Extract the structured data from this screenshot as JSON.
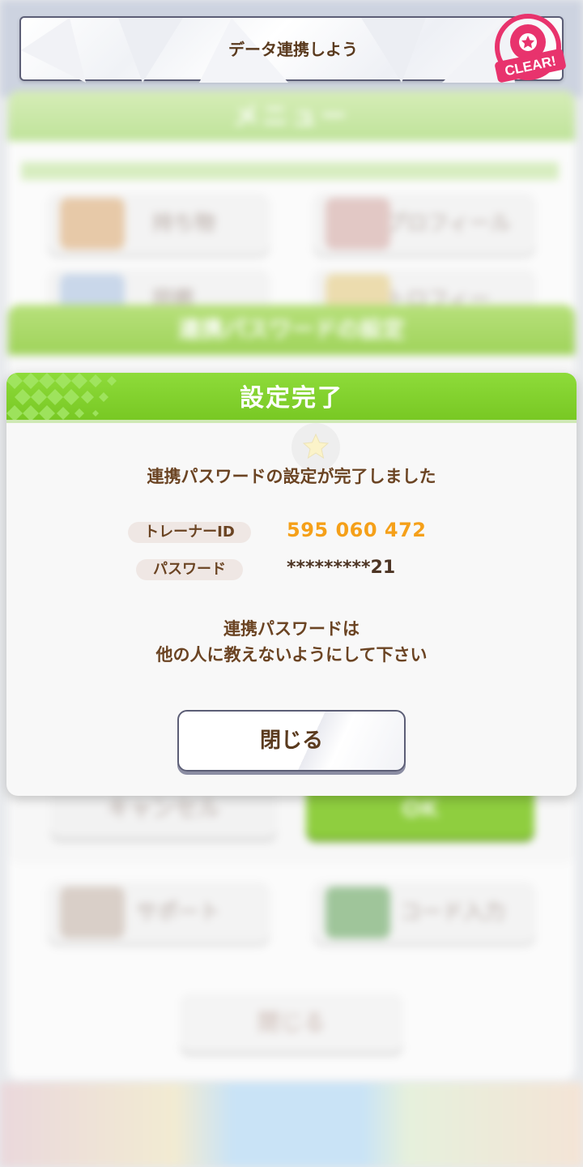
{
  "banner": {
    "title": "データ連携しよう",
    "stamp_text": "CLEAR!"
  },
  "background": {
    "menu_title": "メニュー",
    "tiles": [
      "持ち物",
      "プロフィール",
      "図鑑",
      "トロフィー",
      "サポート",
      "コード入力"
    ],
    "password_panel_title": "連携パスワードの設定",
    "cancel_label": "キャンセル",
    "ok_label": "OK",
    "close_label": "閉じる"
  },
  "dialog": {
    "title": "設定完了",
    "message": "連携パスワードの設定が完了しました",
    "trainer_id_label": "トレーナーID",
    "trainer_id_value": "595 060 472",
    "password_label": "パスワード",
    "password_value": "*********21",
    "warning_line1": "連携パスワードは",
    "warning_line2": "他の人に教えないようにして下さい",
    "close_label": "閉じる"
  },
  "colors": {
    "header_green": "#80d02b",
    "trainer_id_orange": "#f5a019",
    "text_brown": "#6b4423",
    "stamp_pink": "#e8336d"
  }
}
